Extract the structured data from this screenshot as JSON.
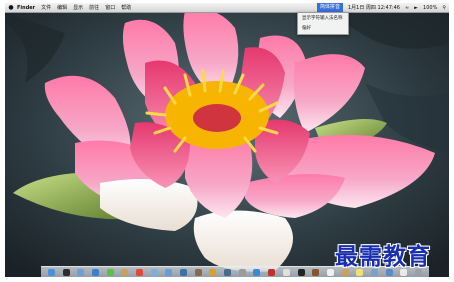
{
  "menubar": {
    "apple_icon": "apple-icon",
    "app_name": "Finder",
    "menus": [
      "文件",
      "编辑",
      "显示",
      "前往",
      "窗口",
      "帮助"
    ],
    "input_menu_label": "简体拼音",
    "status_text": "1月1日 周四 12:47:46",
    "battery_text": "100%"
  },
  "dropdown": {
    "items": [
      "显示字符输入法名称",
      "偏好"
    ]
  },
  "watermark": {
    "text": "最需教育"
  },
  "dock": {
    "icons": [
      "finder-icon",
      "dashboard-icon",
      "mail-icon",
      "safari-icon",
      "ichat-icon",
      "address-book-icon",
      "ical-icon",
      "preview-icon",
      "itunes-icon",
      "iphoto-icon",
      "imovie-icon",
      "garageband-icon",
      "time-machine-icon",
      "system-preferences-icon",
      "app-store-icon",
      "photo-booth-icon",
      "calculator-icon",
      "terminal-icon",
      "font-book-icon",
      "textedit-icon",
      "chess-icon",
      "stickies-icon",
      "folder-icon",
      "downloads-icon",
      "document-icon",
      "trash-icon"
    ]
  },
  "colors": {
    "menu_highlight": "#3a6fd8",
    "watermark": "#1a2fb0"
  }
}
